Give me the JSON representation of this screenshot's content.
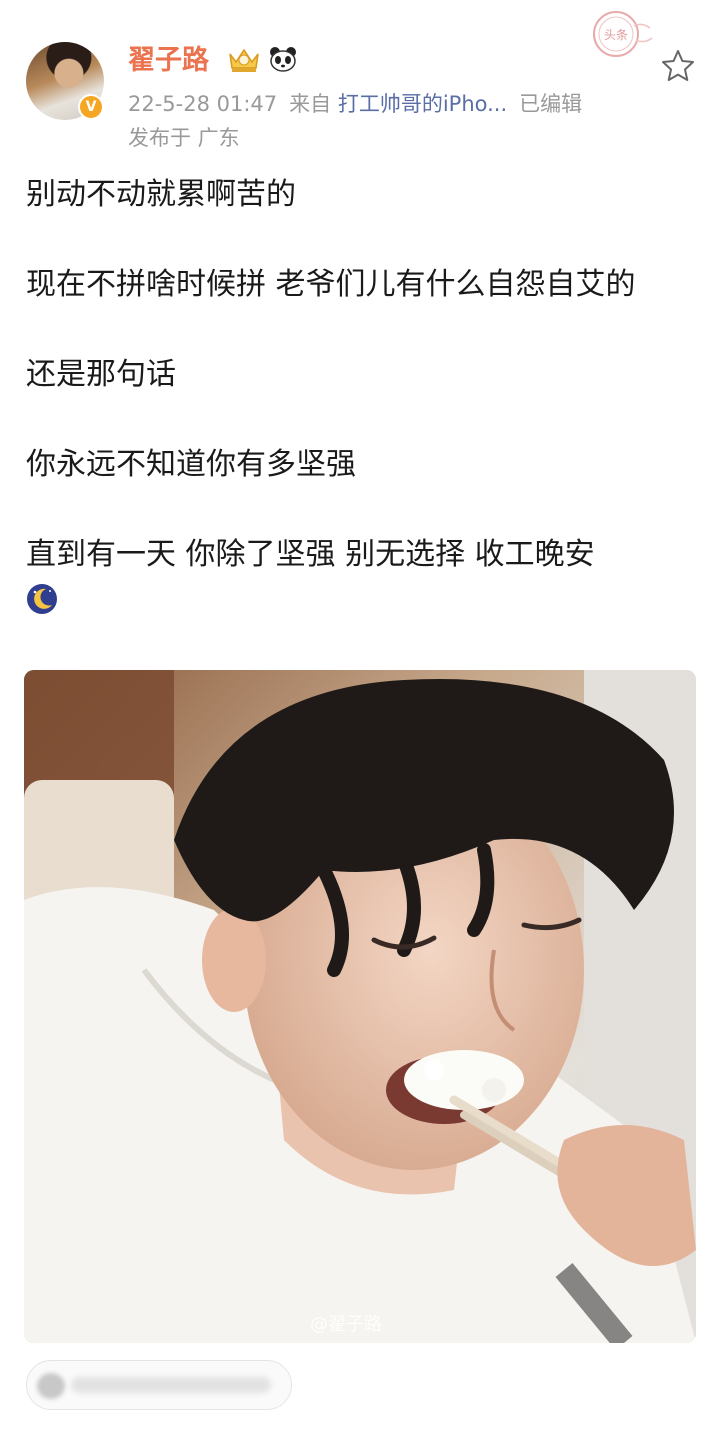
{
  "post": {
    "author": {
      "name": "翟子路",
      "avatar": "avatar",
      "verified_icon": "verified-v-icon",
      "badges": [
        "crown-icon",
        "panda-icon"
      ]
    },
    "meta": {
      "time": "22-5-28 01:47",
      "source_prefix": "来自",
      "source": "打工帅哥的iPho...",
      "edited": "已编辑",
      "location": "发布于 广东"
    },
    "star_icon": "star-outline-icon",
    "stamp": {
      "text": "头条"
    },
    "text_lines": [
      "别动不动就累啊苦的",
      "",
      "现在不拼啥时候拼 老爷们儿有什么自怨自艾的",
      "",
      "还是那句话",
      "",
      "你永远不知道你有多坚强",
      "",
      "直到有一天 你除了坚强 别无选择 收工晚安"
    ],
    "emoji": "moon-icon",
    "image": {
      "description_icon": "photo",
      "watermark": "@翟子路"
    }
  },
  "comment_bar": {
    "avatar": "blurred-avatar",
    "text_blurred": true
  },
  "colors": {
    "username": "#eb7350",
    "source": "#5b6ea6",
    "meta": "#999999"
  }
}
